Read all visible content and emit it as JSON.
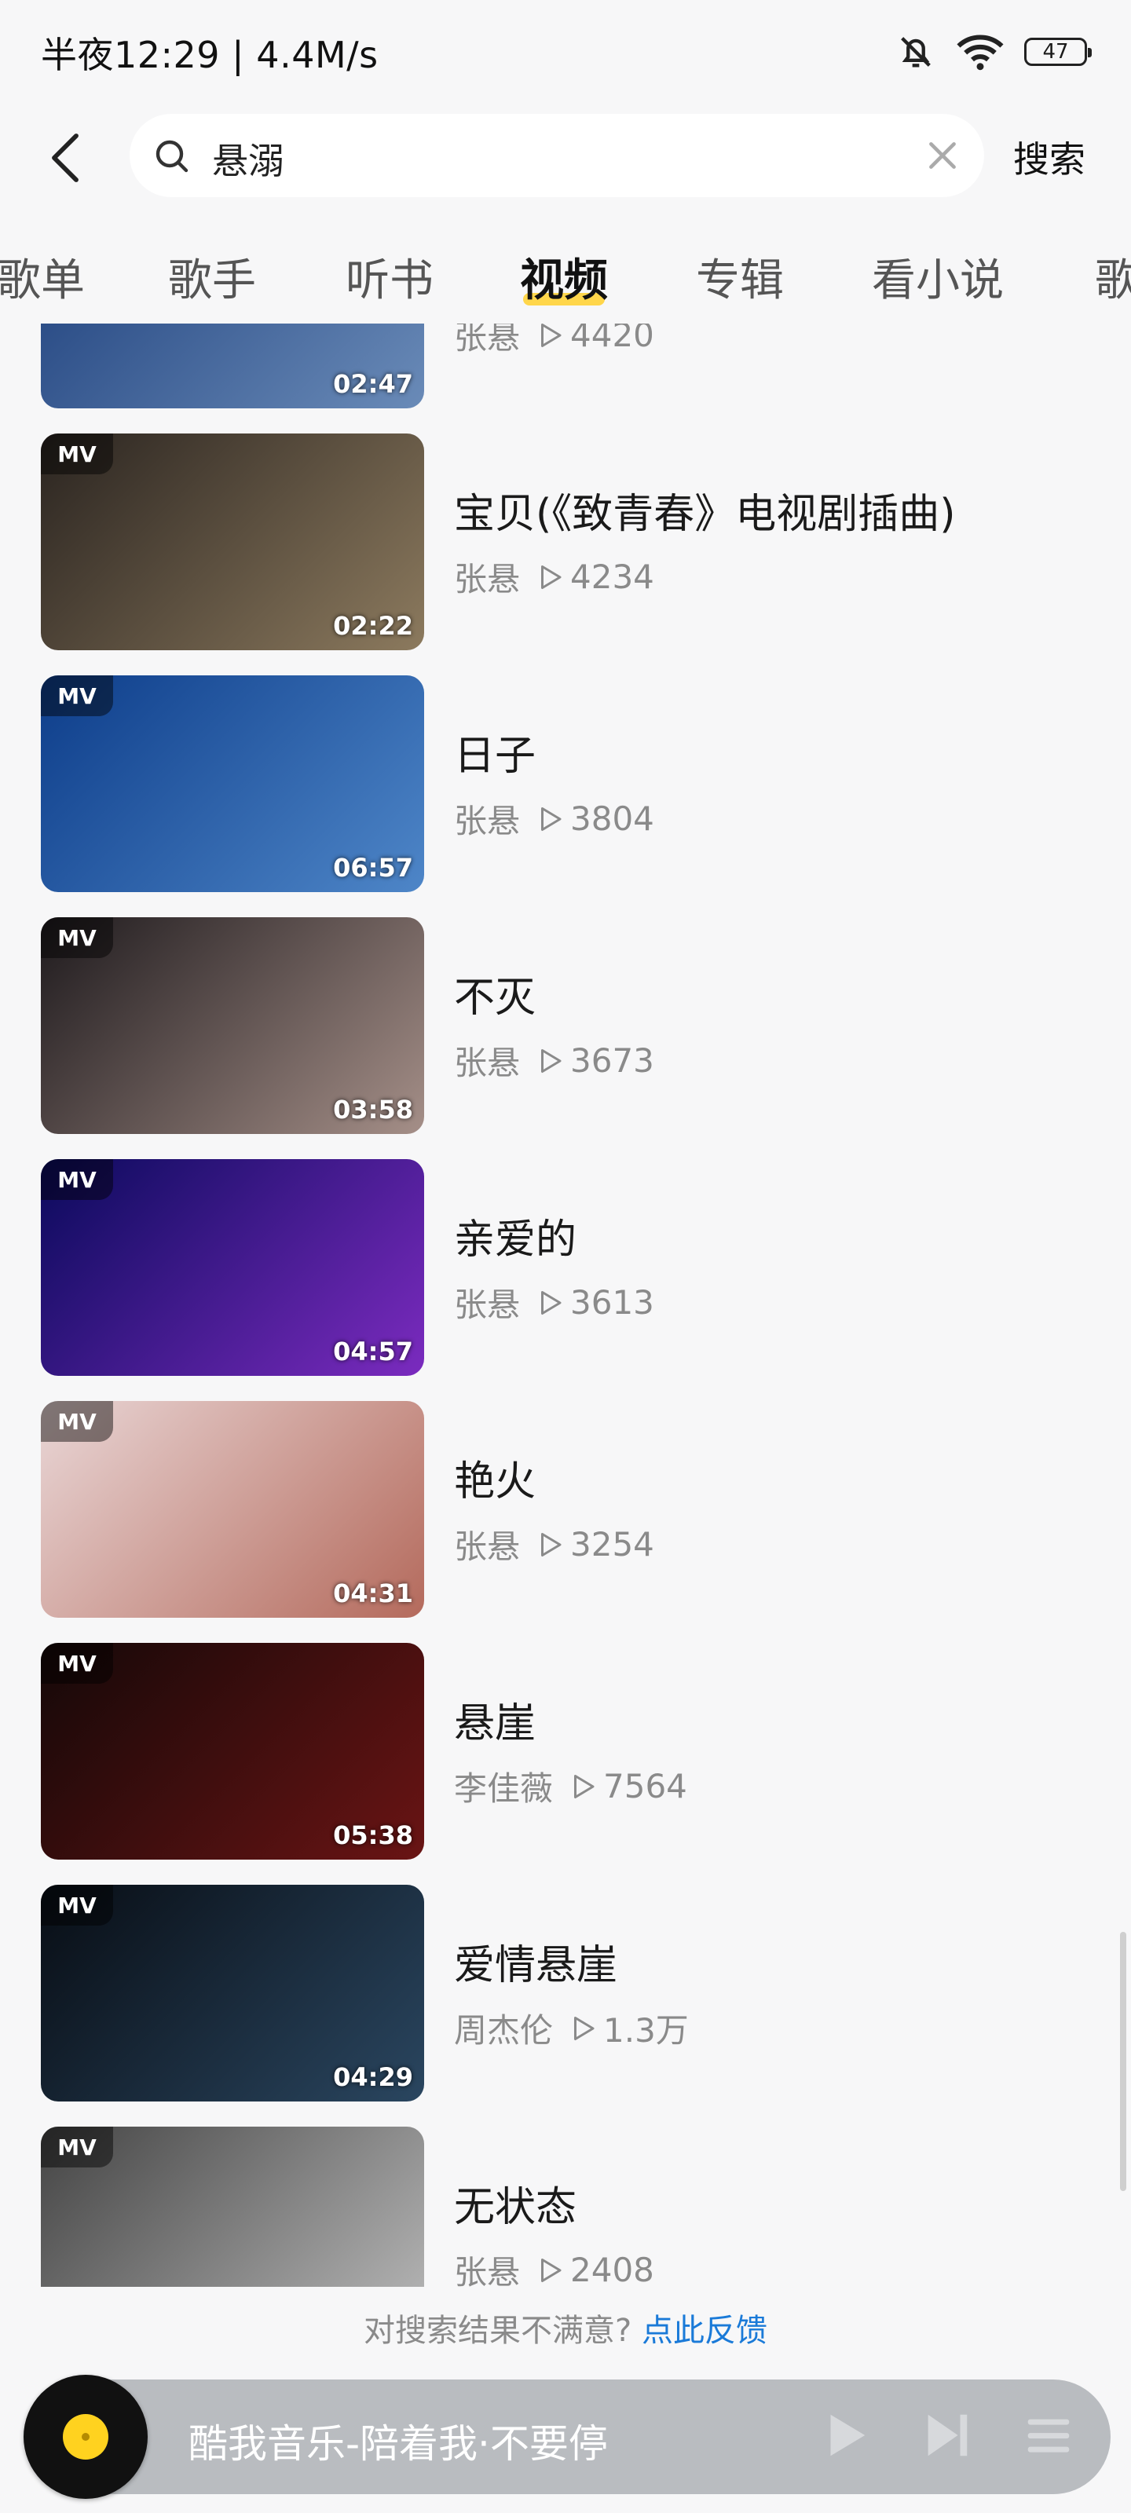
{
  "status_bar": {
    "time": "半夜12:29 | 4.4M/s",
    "battery": "47"
  },
  "search": {
    "query": "悬溺",
    "button": "搜索"
  },
  "tabs": [
    {
      "label": "歌单",
      "active": false
    },
    {
      "label": "歌手",
      "active": false
    },
    {
      "label": "听书",
      "active": false
    },
    {
      "label": "视频",
      "active": true
    },
    {
      "label": "专辑",
      "active": false
    },
    {
      "label": "看小说",
      "active": false
    },
    {
      "label": "歌",
      "active": false
    }
  ],
  "badge": "MV",
  "videos": [
    {
      "title": "",
      "artist": "张悬",
      "plays": "4420",
      "duration": "02:47",
      "colors": [
        "#1b3d7a",
        "#6a8bb8"
      ]
    },
    {
      "title": "宝贝(《致青春》电视剧插曲)",
      "artist": "张悬",
      "plays": "4234",
      "duration": "02:22",
      "colors": [
        "#2a2420",
        "#8c7a5e"
      ]
    },
    {
      "title": "日子",
      "artist": "张悬",
      "plays": "3804",
      "duration": "06:57",
      "colors": [
        "#0d3d8a",
        "#4e86c8"
      ]
    },
    {
      "title": "不灭",
      "artist": "张悬",
      "plays": "3673",
      "duration": "03:58",
      "colors": [
        "#1e1a1d",
        "#a58f88"
      ]
    },
    {
      "title": "亲爱的",
      "artist": "张悬",
      "plays": "3613",
      "duration": "04:57",
      "colors": [
        "#0a0a5c",
        "#7b2bbf"
      ]
    },
    {
      "title": "艳火",
      "artist": "张悬",
      "plays": "3254",
      "duration": "04:31",
      "colors": [
        "#e9d6d6",
        "#b46a5c"
      ]
    },
    {
      "title": "悬崖",
      "artist": "李佳薇",
      "plays": "7564",
      "duration": "05:38",
      "colors": [
        "#140808",
        "#6a1414"
      ]
    },
    {
      "title": "爱情悬崖",
      "artist": "周杰伦",
      "plays": "1.3万",
      "duration": "04:29",
      "colors": [
        "#080d14",
        "#2a4660"
      ]
    },
    {
      "title": "无状态",
      "artist": "张悬",
      "plays": "2408",
      "duration": "",
      "colors": [
        "#444",
        "#bbb"
      ]
    }
  ],
  "feedback": {
    "text": "对搜索结果不满意?",
    "link": "点此反馈"
  },
  "player": {
    "text": "酷我音乐-陪着我·不要停"
  }
}
